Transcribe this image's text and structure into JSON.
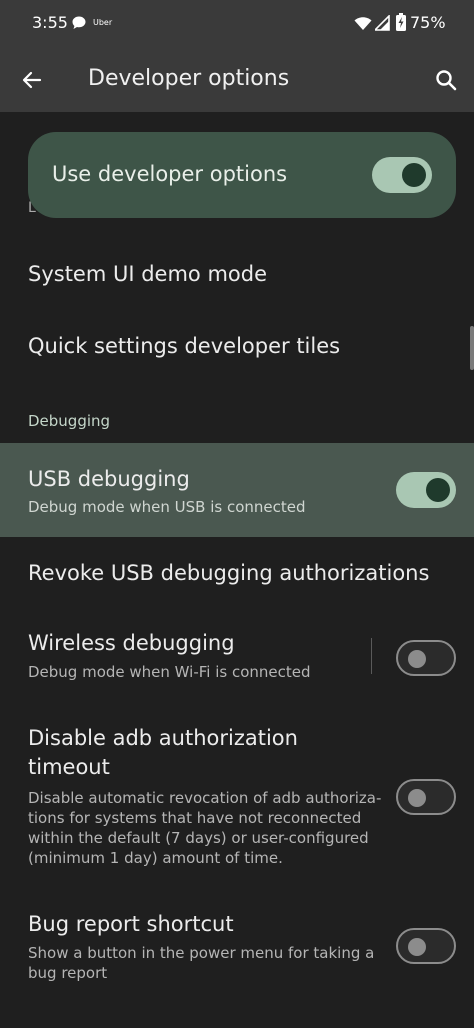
{
  "status_bar": {
    "time": "3:55",
    "notification_app": "Uber",
    "battery_percent": "75%"
  },
  "app_bar": {
    "title": "Developer options"
  },
  "main_toggle": {
    "label": "Use developer options",
    "enabled": true
  },
  "peek_text": "L",
  "rows": {
    "system_ui_demo": {
      "title": "System UI demo mode"
    },
    "quick_settings_tiles": {
      "title": "Quick settings developer tiles"
    },
    "debugging_header": "Debugging",
    "usb_debugging": {
      "title": "USB debugging",
      "subtitle": "Debug mode when USB is connected",
      "enabled": true
    },
    "revoke_usb": {
      "title": "Revoke USB debugging authorizations"
    },
    "wireless_debugging": {
      "title": "Wireless debugging",
      "subtitle": "Debug mode when Wi-Fi is connected",
      "enabled": false
    },
    "disable_adb_timeout": {
      "title_line1": "Disable adb authorization",
      "title_line2": "timeout",
      "subtitle_line1": "Disable automatic revocation of adb authoriza-",
      "subtitle_line2": "tions for systems that have not reconnected",
      "subtitle_line3": "within the default (7 days) or user-configured",
      "subtitle_line4": "(minimum 1 day) amount of time.",
      "enabled": false
    },
    "bug_report_shortcut": {
      "title": "Bug report shortcut",
      "subtitle_line1": "Show a button in the power menu for taking a",
      "subtitle_line2": "bug report",
      "enabled": false
    }
  },
  "colors": {
    "background": "#1f1f1f",
    "app_bar": "#3a3a3a",
    "card": "#3e5548",
    "highlight_row": "#4a5850",
    "switch_on_track": "#a9c7b3",
    "switch_on_knob": "#1f3a2c",
    "section_header": "#c4d6c9"
  },
  "icons": {
    "back": "arrow-left-icon",
    "search": "search-icon",
    "wifi": "wifi-icon",
    "signal": "cell-signal-icon",
    "battery": "battery-charging-icon",
    "message": "chat-bubble-icon"
  }
}
